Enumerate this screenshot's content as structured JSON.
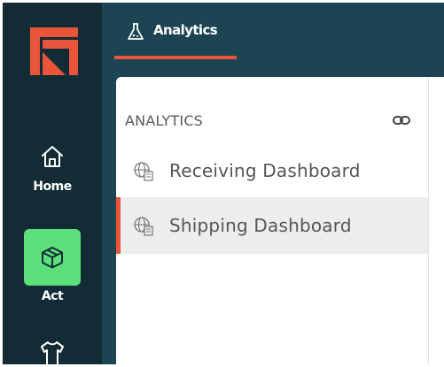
{
  "nav": {
    "home_label": "Home",
    "act_label": "Act",
    "act_color": "#5be07b",
    "background": "#132b35",
    "icons": {
      "logo": "brand-logo",
      "home": "home-icon",
      "act": "box-icon",
      "next": "shirt-icon"
    }
  },
  "topbar": {
    "tab_label": "Analytics",
    "tab_icon": "flask-icon",
    "accent": "#e8553a"
  },
  "panel": {
    "section_title": "ANALYTICS",
    "link_icon": "link-icon",
    "items": [
      {
        "label": "Receiving Dashboard",
        "icon": "globe-doc-icon",
        "active": false
      },
      {
        "label": "Shipping Dashboard",
        "icon": "globe-doc-icon",
        "active": true
      }
    ]
  }
}
